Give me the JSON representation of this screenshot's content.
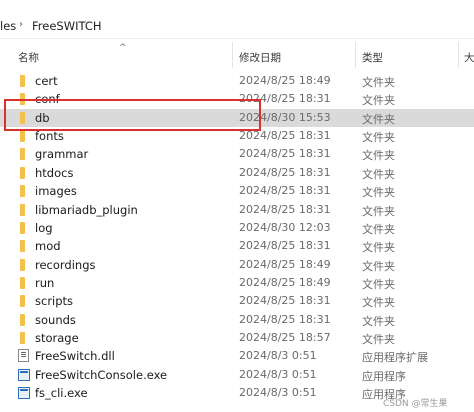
{
  "breadcrumb": {
    "parent": "les",
    "current": "FreeSWITCH",
    "separator": "›"
  },
  "columns": {
    "name": "名称",
    "date": "修改日期",
    "type": "类型",
    "size": "大"
  },
  "files": [
    {
      "name": "cert",
      "date": "2024/8/25 18:49",
      "type": "文件夹",
      "icon": "folder-icon"
    },
    {
      "name": "conf",
      "date": "2024/8/25 18:31",
      "type": "文件夹",
      "icon": "folder-icon"
    },
    {
      "name": "db",
      "date": "2024/8/30 15:53",
      "type": "文件夹",
      "icon": "folder-icon",
      "selected": true
    },
    {
      "name": "fonts",
      "date": "2024/8/25 18:31",
      "type": "文件夹",
      "icon": "folder-icon"
    },
    {
      "name": "grammar",
      "date": "2024/8/25 18:31",
      "type": "文件夹",
      "icon": "folder-icon"
    },
    {
      "name": "htdocs",
      "date": "2024/8/25 18:31",
      "type": "文件夹",
      "icon": "folder-icon"
    },
    {
      "name": "images",
      "date": "2024/8/25 18:31",
      "type": "文件夹",
      "icon": "folder-icon"
    },
    {
      "name": "libmariadb_plugin",
      "date": "2024/8/25 18:31",
      "type": "文件夹",
      "icon": "folder-icon"
    },
    {
      "name": "log",
      "date": "2024/8/30 12:03",
      "type": "文件夹",
      "icon": "folder-icon"
    },
    {
      "name": "mod",
      "date": "2024/8/25 18:31",
      "type": "文件夹",
      "icon": "folder-icon"
    },
    {
      "name": "recordings",
      "date": "2024/8/25 18:49",
      "type": "文件夹",
      "icon": "folder-icon"
    },
    {
      "name": "run",
      "date": "2024/8/25 18:49",
      "type": "文件夹",
      "icon": "folder-icon"
    },
    {
      "name": "scripts",
      "date": "2024/8/25 18:31",
      "type": "文件夹",
      "icon": "folder-icon"
    },
    {
      "name": "sounds",
      "date": "2024/8/25 18:31",
      "type": "文件夹",
      "icon": "folder-icon"
    },
    {
      "name": "storage",
      "date": "2024/8/25 18:57",
      "type": "文件夹",
      "icon": "folder-icon"
    },
    {
      "name": "FreeSwitch.dll",
      "date": "2024/8/3 0:51",
      "type": "应用程序扩展",
      "icon": "dll-file-icon"
    },
    {
      "name": "FreeSwitchConsole.exe",
      "date": "2024/8/3 0:51",
      "type": "应用程序",
      "icon": "exe-file-icon"
    },
    {
      "name": "fs_cli.exe",
      "date": "2024/8/3 0:51",
      "type": "应用程序",
      "icon": "exe-file-icon"
    }
  ],
  "watermark": "CSDN @常生果"
}
